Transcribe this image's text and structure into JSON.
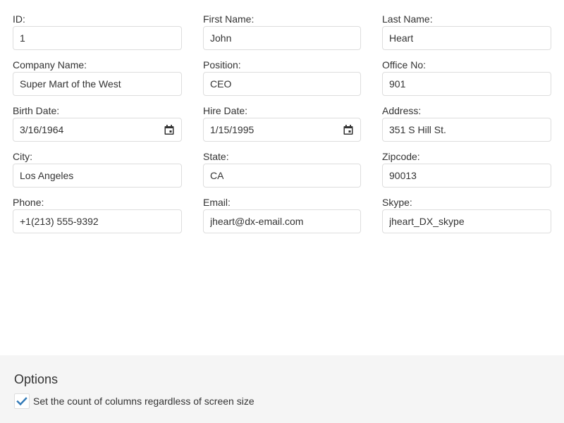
{
  "form": {
    "id": {
      "label": "ID:",
      "value": "1"
    },
    "first_name": {
      "label": "First Name:",
      "value": "John"
    },
    "last_name": {
      "label": "Last Name:",
      "value": "Heart"
    },
    "company_name": {
      "label": "Company Name:",
      "value": "Super Mart of the West"
    },
    "position": {
      "label": "Position:",
      "value": "CEO"
    },
    "office_no": {
      "label": "Office No:",
      "value": "901"
    },
    "birth_date": {
      "label": "Birth Date:",
      "value": "3/16/1964",
      "icon": "calendar-icon"
    },
    "hire_date": {
      "label": "Hire Date:",
      "value": "1/15/1995",
      "icon": "calendar-icon"
    },
    "address": {
      "label": "Address:",
      "value": "351 S Hill St."
    },
    "city": {
      "label": "City:",
      "value": "Los Angeles"
    },
    "state": {
      "label": "State:",
      "value": "CA"
    },
    "zipcode": {
      "label": "Zipcode:",
      "value": "90013"
    },
    "phone": {
      "label": "Phone:",
      "value": "+1(213) 555-9392"
    },
    "email": {
      "label": "Email:",
      "value": "jheart@dx-email.com"
    },
    "skype": {
      "label": "Skype:",
      "value": "jheart_DX_skype"
    }
  },
  "options": {
    "title": "Options",
    "column_count_checkbox": {
      "label": "Set the count of columns regardless of screen size",
      "checked": true,
      "check_color": "#337ab7"
    }
  },
  "colors": {
    "field_border": "#dddddd",
    "text": "#333333",
    "options_background": "#f5f5f5"
  }
}
